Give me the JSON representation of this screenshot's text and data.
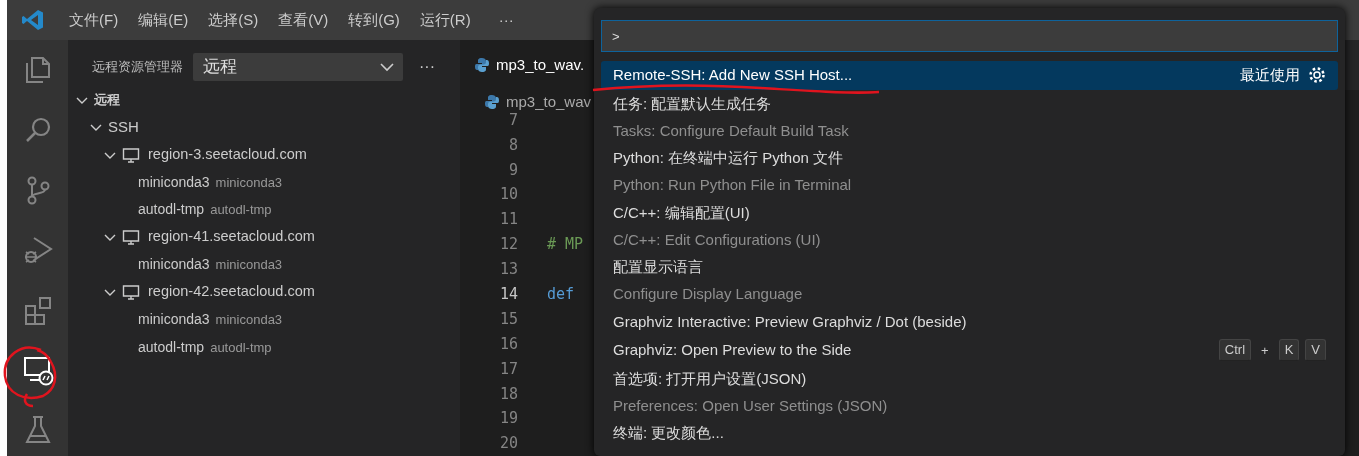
{
  "menu_bar": {
    "items": [
      "文件(F)",
      "编辑(E)",
      "选择(S)",
      "查看(V)",
      "转到(G)",
      "运行(R)"
    ],
    "more": "···"
  },
  "activity_bar": [
    {
      "kind": "explorer",
      "selected": false
    },
    {
      "kind": "search",
      "selected": false
    },
    {
      "kind": "source-control",
      "selected": false
    },
    {
      "kind": "run-debug",
      "selected": false
    },
    {
      "kind": "extensions",
      "selected": false
    },
    {
      "kind": "remote",
      "selected": true
    },
    {
      "kind": "testing",
      "selected": false
    }
  ],
  "sidebar": {
    "title": "远程资源管理器",
    "dropdown": "远程",
    "more": "···",
    "tree": [
      {
        "label": "远程",
        "kind": "section",
        "expanded": true,
        "children": [
          {
            "label": "SSH",
            "kind": "group",
            "expanded": true,
            "children": [
              {
                "label": "region-3.seetacloud.com",
                "kind": "host",
                "expanded": true,
                "children": [
                  {
                    "label": "miniconda3",
                    "description": "miniconda3",
                    "kind": "folder"
                  },
                  {
                    "label": "autodl-tmp",
                    "description": "autodl-tmp",
                    "kind": "folder"
                  }
                ]
              },
              {
                "label": "region-41.seetacloud.com",
                "kind": "host",
                "expanded": true,
                "children": [
                  {
                    "label": "miniconda3",
                    "description": "miniconda3",
                    "kind": "folder"
                  }
                ]
              },
              {
                "label": "region-42.seetacloud.com",
                "kind": "host",
                "expanded": true,
                "children": [
                  {
                    "label": "miniconda3",
                    "description": "miniconda3",
                    "kind": "folder"
                  },
                  {
                    "label": "autodl-tmp",
                    "description": "autodl-tmp",
                    "kind": "folder"
                  }
                ]
              }
            ]
          }
        ]
      }
    ]
  },
  "editor": {
    "tab": "mp3_to_wav.",
    "breadcrumb": "mp3_to_wav",
    "lines": [
      {
        "number": "7",
        "current": false
      },
      {
        "number": "8",
        "current": false
      },
      {
        "number": "9",
        "current": false
      },
      {
        "number": "10",
        "current": false
      },
      {
        "number": "11",
        "current": false
      },
      {
        "number": "12",
        "current": false,
        "code": "# MP",
        "kind": "comment"
      },
      {
        "number": "13",
        "current": false
      },
      {
        "number": "14",
        "current": true,
        "code": "def",
        "kind": "keyword"
      },
      {
        "number": "15",
        "current": false
      },
      {
        "number": "16",
        "current": false
      },
      {
        "number": "17",
        "current": false
      },
      {
        "number": "18",
        "current": false
      },
      {
        "number": "19",
        "current": false
      },
      {
        "number": "20",
        "current": false
      }
    ]
  },
  "command_palette": {
    "value": ">",
    "items": [
      {
        "label": "Remote-SSH: Add New SSH Host...",
        "selected": true,
        "tag": "最近使用"
      },
      {
        "label": "任务: 配置默认生成任务",
        "detail": "Tasks: Configure Default Build Task",
        "selected": false
      },
      {
        "label": "Python: 在终端中运行 Python 文件",
        "detail": "Python: Run Python File in Terminal",
        "selected": false
      },
      {
        "label": "C/C++: 编辑配置(UI)",
        "detail": "C/C++: Edit Configurations (UI)",
        "selected": false
      },
      {
        "label": "配置显示语言",
        "detail": "Configure Display Language",
        "selected": false
      },
      {
        "label": "Graphviz Interactive: Preview Graphviz / Dot (beside)",
        "selected": false
      },
      {
        "label": "Graphviz: Open Preview to the Side",
        "selected": false,
        "keybinding": [
          {
            "text": "Ctrl",
            "kind": "key"
          },
          {
            "text": "+",
            "kind": "plus"
          },
          {
            "text": "K",
            "kind": "key"
          },
          {
            "text": "V",
            "kind": "key"
          }
        ]
      },
      {
        "label": "首选项: 打开用户设置(JSON)",
        "detail": "Preferences: Open User Settings (JSON)",
        "selected": false
      },
      {
        "label": "终端: 更改颜色...",
        "selected": false
      }
    ]
  }
}
